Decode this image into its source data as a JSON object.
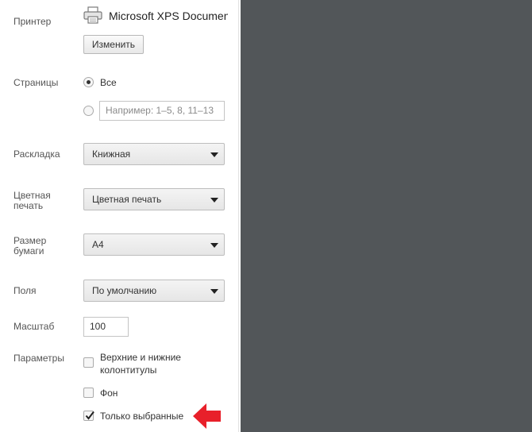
{
  "printer": {
    "label": "Принтер",
    "name": "Microsoft XPS Document Writer",
    "change_button": "Изменить"
  },
  "pages": {
    "label": "Страницы",
    "all_option": "Все",
    "custom_placeholder": "Например: 1–5, 8, 11–13"
  },
  "layout": {
    "label": "Раскладка",
    "value": "Книжная"
  },
  "color": {
    "label_line1": "Цветная",
    "label_line2": "печать",
    "value": "Цветная печать"
  },
  "paper": {
    "label_line1": "Размер",
    "label_line2": "бумаги",
    "value": "A4"
  },
  "margins": {
    "label": "Поля",
    "value": "По умолчанию"
  },
  "scale": {
    "label": "Масштаб",
    "value": "100"
  },
  "options": {
    "label": "Параметры",
    "headers_footers_line1": "Верхние и нижние",
    "headers_footers_line2": "колонтитулы",
    "headers_footers_checked": false,
    "background": "Фон",
    "background_checked": false,
    "selection_only": "Только выбранные",
    "selection_only_checked": true
  },
  "colors": {
    "preview_background": "#525659",
    "annotation_arrow": "#e8202a"
  },
  "icons": {
    "printer": "printer-icon",
    "dropdown": "chevron-down-icon",
    "checkmark": "checkmark-icon",
    "annotation": "red-arrow-icon"
  }
}
